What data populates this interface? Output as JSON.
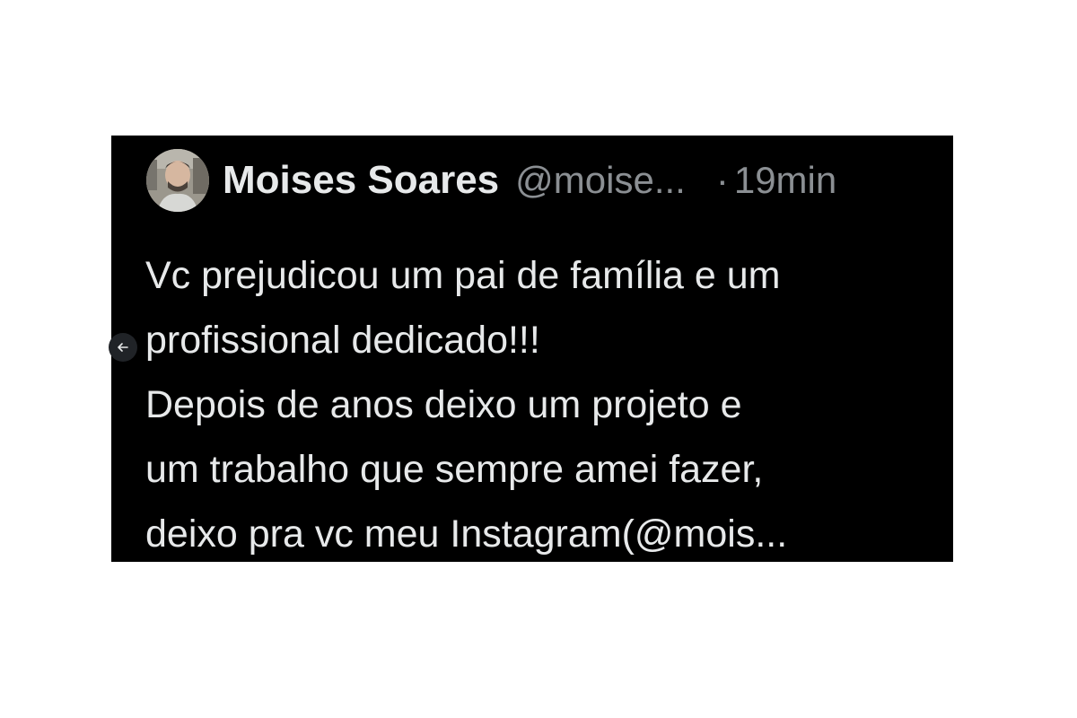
{
  "tweet": {
    "author_name": "Moises Soares",
    "author_handle": "@moise...",
    "separator": "·",
    "time_ago": "19min",
    "avatar_icon": "user-photo-avatar",
    "body_lines": [
      "Vc prejudicou um pai de família e um",
      "profissional dedicado!!!",
      "Depois de anos deixo um projeto e",
      "um trabalho que sempre amei fazer,",
      "deixo pra vc meu Instagram(@mois..."
    ]
  },
  "controls": {
    "back_icon": "arrow-left-icon"
  },
  "colors": {
    "card_background": "#000000",
    "primary_text": "#e7e9ea",
    "secondary_text": "#8b8f93",
    "page_background": "#ffffff"
  }
}
